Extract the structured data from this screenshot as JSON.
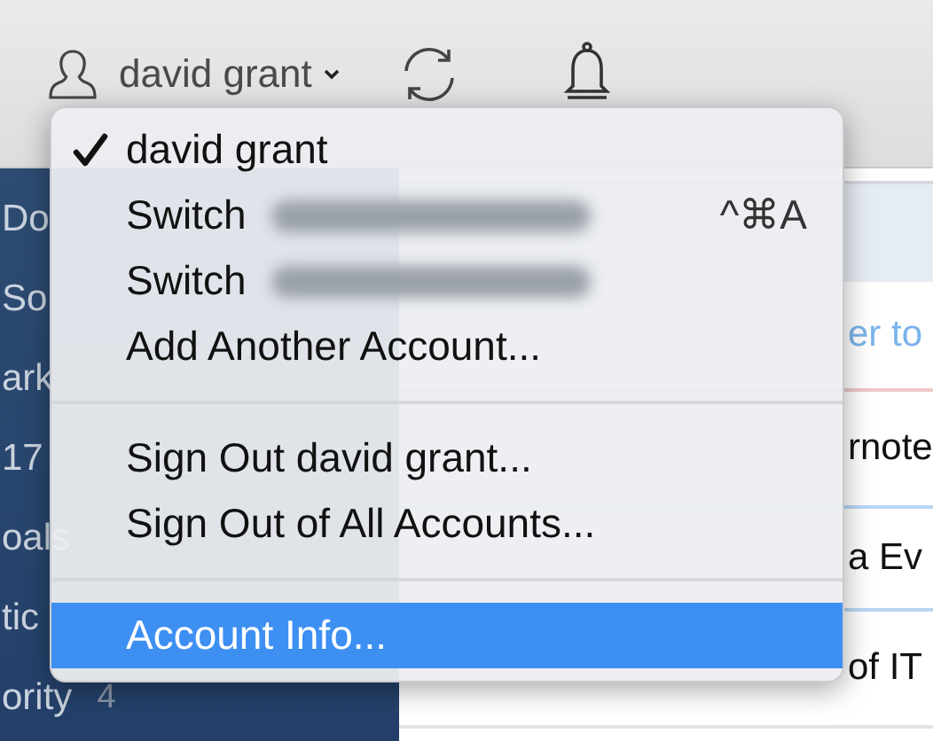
{
  "toolbar": {
    "account_name": "david grant"
  },
  "sidebar": {
    "items": [
      {
        "label": "Do"
      },
      {
        "label": "So"
      },
      {
        "label": "ark"
      },
      {
        "label": "17"
      },
      {
        "label": "oals"
      },
      {
        "label": "tic"
      },
      {
        "label": "ority",
        "count": "4"
      }
    ]
  },
  "notes": {
    "rows": [
      {
        "kind": "link",
        "text": "er to"
      },
      {
        "kind": "text",
        "text": "rnote"
      },
      {
        "kind": "text",
        "text": "a Ev"
      },
      {
        "kind": "text",
        "text": "of IT"
      }
    ]
  },
  "menu": {
    "items": [
      {
        "kind": "item",
        "label": "david grant",
        "checked": true,
        "selected": false,
        "redacted": false
      },
      {
        "kind": "item",
        "label": "Switch",
        "checked": false,
        "selected": false,
        "redacted": true,
        "shortcut": "^⌘A"
      },
      {
        "kind": "item",
        "label": "Switch",
        "checked": false,
        "selected": false,
        "redacted": true
      },
      {
        "kind": "item",
        "label": "Add Another Account...",
        "checked": false,
        "selected": false,
        "redacted": false
      },
      {
        "kind": "separator"
      },
      {
        "kind": "item",
        "label": "Sign Out david grant...",
        "checked": false,
        "selected": false,
        "redacted": false
      },
      {
        "kind": "item",
        "label": "Sign Out of All Accounts...",
        "checked": false,
        "selected": false,
        "redacted": false
      },
      {
        "kind": "separator"
      },
      {
        "kind": "item",
        "label": "Account Info...",
        "checked": false,
        "selected": true,
        "redacted": false
      }
    ]
  }
}
